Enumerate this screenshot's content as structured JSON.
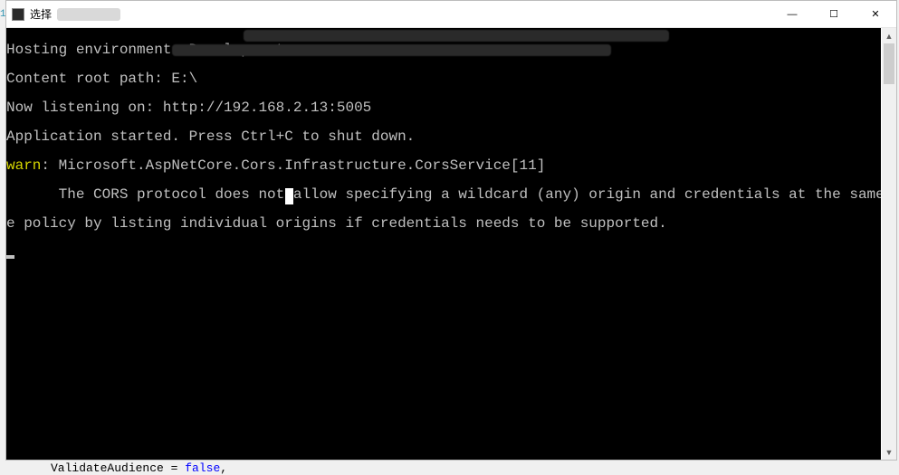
{
  "window": {
    "title_prefix": "选择"
  },
  "terminal": {
    "lines": {
      "l0": "Hosting environment: Development",
      "l1": "Content root path: E:\\",
      "l2": "Now listening on: http://192.168.2.13:5005",
      "l3": "Application started. Press Ctrl+C to shut down.",
      "l4_warn": "warn",
      "l4_rest": ": Microsoft.AspNetCore.Cors.Infrastructure.CorsService[11]",
      "l5": "      The CORS protocol does not allow specifying a wildcard (any) origin and credentials at the same time. Configure th",
      "l6": "e policy by listing individual origins if credentials needs to be supported."
    }
  },
  "titlebar_controls": {
    "minimize": "—",
    "maximize": "☐",
    "close": "✕"
  },
  "scrollbar": {
    "up": "▲",
    "down": "▼"
  },
  "code_peek": {
    "ident": "ValidateAudience",
    "op": " = ",
    "value": "false",
    "tail": ","
  },
  "left_badge": "1"
}
